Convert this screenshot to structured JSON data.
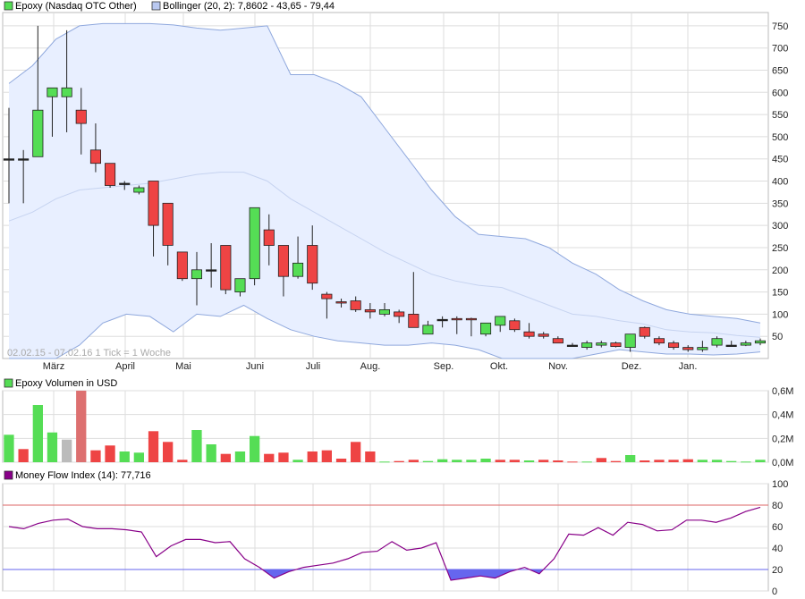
{
  "legend": {
    "price_label": "Epoxy (Nasdaq OTC Other)",
    "bollinger_label": "Bollinger (20, 2): 7,8602 - 43,65 - 79,44",
    "volume_label": "Epoxy Volumen in USD",
    "mfi_label": "Money Flow Index (14): 77,716"
  },
  "range_note": "02.02.15 - 07.02.16   1 Tick = 1 Woche",
  "colors": {
    "up": "#55dd55",
    "down": "#ee4444",
    "neutral": "#bbbbbb",
    "band_fill": "#e8efff",
    "band_line": "#8fa8dd",
    "mfi_line": "#880088",
    "mfi_fill": "#6666ee",
    "level80": "#dd6666",
    "level20": "#6666ee",
    "grid": "#dddddd"
  },
  "x_labels": [
    "März",
    "April",
    "Mai",
    "Juni",
    "Juli",
    "Aug.",
    "Sep.",
    "Okt.",
    "Nov.",
    "Dez.",
    "Jan."
  ],
  "chart_data": [
    {
      "type": "candlestick",
      "title": "Epoxy (Nasdaq OTC Other)",
      "ylim": [
        0,
        780
      ],
      "yticks": [
        50,
        100,
        150,
        200,
        250,
        300,
        350,
        400,
        450,
        500,
        550,
        600,
        650,
        700,
        750
      ],
      "ohlc": [
        [
          450,
          565,
          350,
          450
        ],
        [
          450,
          470,
          350,
          450
        ],
        [
          455,
          750,
          455,
          560
        ],
        [
          590,
          610,
          500,
          610
        ],
        [
          590,
          740,
          510,
          610
        ],
        [
          560,
          610,
          460,
          530
        ],
        [
          470,
          530,
          420,
          440
        ],
        [
          440,
          440,
          385,
          390
        ],
        [
          395,
          400,
          380,
          395
        ],
        [
          375,
          390,
          370,
          385
        ],
        [
          400,
          400,
          230,
          300
        ],
        [
          350,
          350,
          210,
          255
        ],
        [
          240,
          240,
          175,
          180
        ],
        [
          180,
          240,
          120,
          200
        ],
        [
          200,
          260,
          160,
          200
        ],
        [
          255,
          255,
          145,
          155
        ],
        [
          150,
          175,
          140,
          180
        ],
        [
          180,
          340,
          165,
          340
        ],
        [
          290,
          325,
          210,
          255
        ],
        [
          255,
          255,
          140,
          185
        ],
        [
          185,
          275,
          180,
          215
        ],
        [
          255,
          300,
          155,
          170
        ],
        [
          145,
          150,
          90,
          135
        ],
        [
          128,
          135,
          115,
          125
        ],
        [
          130,
          140,
          105,
          110
        ],
        [
          110,
          125,
          90,
          105
        ],
        [
          100,
          125,
          95,
          110
        ],
        [
          105,
          110,
          80,
          95
        ],
        [
          100,
          195,
          70,
          70
        ],
        [
          55,
          85,
          55,
          75
        ],
        [
          88,
          95,
          70,
          88
        ],
        [
          90,
          95,
          55,
          88
        ],
        [
          90,
          92,
          50,
          88
        ],
        [
          55,
          80,
          50,
          80
        ],
        [
          75,
          95,
          60,
          95
        ],
        [
          85,
          90,
          60,
          65
        ],
        [
          60,
          80,
          45,
          50
        ],
        [
          55,
          60,
          45,
          50
        ],
        [
          45,
          50,
          35,
          35
        ],
        [
          30,
          35,
          28,
          30
        ],
        [
          25,
          40,
          20,
          35
        ],
        [
          30,
          40,
          25,
          35
        ],
        [
          35,
          38,
          25,
          27
        ],
        [
          25,
          55,
          15,
          55
        ],
        [
          70,
          72,
          45,
          50
        ],
        [
          45,
          50,
          30,
          35
        ],
        [
          35,
          40,
          20,
          25
        ],
        [
          25,
          30,
          15,
          20
        ],
        [
          20,
          40,
          15,
          25
        ],
        [
          30,
          50,
          25,
          45
        ],
        [
          30,
          40,
          28,
          30
        ],
        [
          30,
          40,
          28,
          35
        ],
        [
          35,
          45,
          30,
          40
        ]
      ],
      "bollinger_upper": [
        620,
        660,
        720,
        750,
        755,
        755,
        755,
        752,
        745,
        740,
        745,
        750,
        640,
        640,
        620,
        590,
        520,
        450,
        380,
        320,
        280,
        275,
        270,
        250,
        215,
        190,
        155,
        130,
        110,
        100,
        95,
        90,
        80
      ],
      "bollinger_middle": [
        310,
        330,
        360,
        380,
        385,
        390,
        395,
        405,
        415,
        420,
        420,
        400,
        360,
        330,
        300,
        270,
        240,
        215,
        190,
        175,
        165,
        160,
        140,
        120,
        100,
        95,
        85,
        78,
        65,
        60,
        58,
        52,
        48
      ],
      "bollinger_lower": [
        0,
        0,
        0,
        30,
        80,
        100,
        95,
        60,
        100,
        95,
        120,
        90,
        65,
        50,
        40,
        35,
        30,
        30,
        35,
        30,
        20,
        0,
        0,
        0,
        0,
        10,
        20,
        15,
        10,
        10,
        8,
        10,
        15
      ],
      "categories": [
        "März",
        "April",
        "Mai",
        "Juni",
        "Juli",
        "Aug.",
        "Sep.",
        "Okt.",
        "Nov.",
        "Dez.",
        "Jan."
      ]
    },
    {
      "type": "bar",
      "title": "Epoxy Volumen in USD",
      "ylim": [
        0,
        0.6
      ],
      "ytick_labels": [
        "0,0M",
        "0,2M",
        "0,4M",
        "0,6M"
      ],
      "values": [
        0.23,
        0.11,
        0.48,
        0.25,
        0.19,
        0.8,
        0.1,
        0.14,
        0.09,
        0.08,
        0.26,
        0.17,
        0.02,
        0.27,
        0.15,
        0.07,
        0.09,
        0.22,
        0.07,
        0.08,
        0.02,
        0.09,
        0.1,
        0.03,
        0.17,
        0.09,
        0.005,
        0.01,
        0.02,
        0.01,
        0.025,
        0.02,
        0.02,
        0.03,
        0.02,
        0.02,
        0.015,
        0.02,
        0.015,
        0.005,
        0.005,
        0.035,
        0.01,
        0.06,
        0.015,
        0.02,
        0.02,
        0.025,
        0.02,
        0.02,
        0.01,
        0.005,
        0.02
      ],
      "up_flags": [
        1,
        0,
        1,
        1,
        0,
        0,
        0,
        0,
        1,
        1,
        0,
        0,
        0,
        1,
        1,
        0,
        1,
        1,
        0,
        0,
        1,
        0,
        0,
        0,
        0,
        0,
        1,
        0,
        0,
        1,
        1,
        1,
        1,
        1,
        0,
        0,
        1,
        0,
        0,
        0,
        1,
        0,
        0,
        1,
        0,
        0,
        0,
        0,
        1,
        1,
        1,
        1,
        1
      ]
    },
    {
      "type": "line",
      "title": "Money Flow Index (14)",
      "ylim": [
        0,
        100
      ],
      "yticks": [
        0,
        20,
        40,
        60,
        80,
        100
      ],
      "levels": [
        20,
        80
      ],
      "values": [
        60,
        58,
        63,
        66,
        67,
        60,
        58,
        58,
        57,
        55,
        32,
        42,
        48,
        48,
        45,
        46,
        30,
        22,
        12,
        18,
        22,
        24,
        26,
        30,
        36,
        37,
        46,
        38,
        40,
        45,
        10,
        12,
        14,
        12,
        18,
        22,
        16,
        30,
        53,
        52,
        59,
        52,
        64,
        62,
        56,
        57,
        66,
        66,
        64,
        68,
        74,
        78
      ]
    }
  ]
}
